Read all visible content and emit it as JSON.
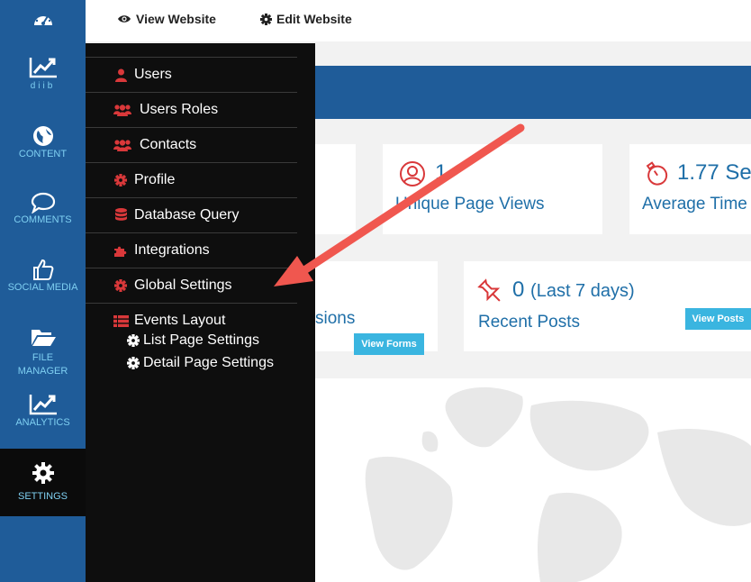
{
  "leftnav": {
    "items": [
      {
        "label": "",
        "icon": "dashboard-icon"
      },
      {
        "label": "diib",
        "icon": "trend-chart-icon"
      },
      {
        "label": "CONTENT",
        "icon": "globe-icon"
      },
      {
        "label": "COMMENTS",
        "icon": "speech-bubble-icon"
      },
      {
        "label": "SOCIAL MEDIA",
        "icon": "thumbs-up-icon"
      },
      {
        "label": "FILE MANAGER",
        "icon": "folder-icon"
      },
      {
        "label": "ANALYTICS",
        "icon": "trend-chart-icon"
      },
      {
        "label": "SETTINGS",
        "icon": "gear-icon"
      }
    ]
  },
  "topbar": {
    "view_website": "View Website",
    "edit_website": "Edit Website"
  },
  "dashboard": {
    "unique_views_num": "1",
    "unique_views_label": "Unique Page Views",
    "avg_time_num": "1.77 Se",
    "avg_time_label": "Average Time",
    "submissions_label": "sions",
    "view_forms": "View Forms",
    "recent_posts_num": "0",
    "recent_posts_sub": "(Last 7 days)",
    "recent_posts_label": "Recent Posts",
    "view_posts": "View Posts"
  },
  "settings_menu": {
    "items": [
      {
        "label": "Users",
        "icon": "user-icon"
      },
      {
        "label": "Users Roles",
        "icon": "users-group-icon"
      },
      {
        "label": "Contacts",
        "icon": "users-group-icon"
      },
      {
        "label": "Profile",
        "icon": "gear-icon"
      },
      {
        "label": "Database Query",
        "icon": "database-icon"
      },
      {
        "label": "Integrations",
        "icon": "puzzle-icon"
      },
      {
        "label": "Global Settings",
        "icon": "gear-icon"
      },
      {
        "label": "Events Layout",
        "icon": "list-icon"
      }
    ],
    "subitems": [
      {
        "label": "List Page Settings",
        "icon": "gear-icon"
      },
      {
        "label": "Detail Page Settings",
        "icon": "gear-icon"
      }
    ]
  },
  "colors": {
    "nav_blue": "#1f5c99",
    "menu_black": "#0e0e0e",
    "accent_red": "#d9383a",
    "link_blue": "#1f6fa8",
    "button_cyan": "#3ab5e0",
    "arrow": "#f0574f"
  }
}
